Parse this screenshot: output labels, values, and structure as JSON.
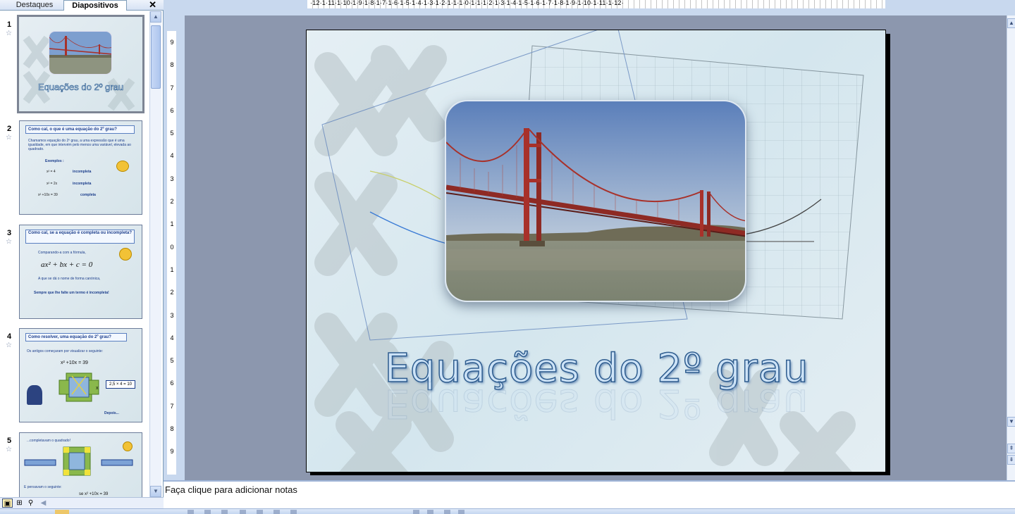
{
  "panel": {
    "tabs": [
      "Destaques",
      "Diapositivos"
    ],
    "active_tab": "Diapositivos",
    "close_glyph": "✕"
  },
  "thumbnails": [
    {
      "number": "1",
      "title": "Equações do 2º grau",
      "selected": true
    },
    {
      "number": "2",
      "heading": "Como cal, o que é uma equação do 2º grau?",
      "body": "Chamamos equação do 2º grau, a uma expressão que é uma igualdade, em que intervém pelo menos uma variável, elevada ao quadrado.",
      "examples_label": "Exemplos :",
      "examples": [
        {
          "expr": "x² = 4",
          "result": "incompleta"
        },
        {
          "expr": "x² = 2x",
          "result": "incompleta"
        },
        {
          "expr": "x² +10x = 39",
          "result": "completa"
        }
      ]
    },
    {
      "number": "3",
      "heading": "Como cal, se a equação é completa ou incompleta?",
      "line1": "Comparando-a com a fórmula,",
      "formula": "ax² + bx + c = 0",
      "line2": "A que se dá o nome de forma canónica,",
      "line3": "Sempre que lhe falte um termo é incompleta!"
    },
    {
      "number": "4",
      "heading": "Como resolver, uma equação do 2º grau?",
      "line1": "Os antigos começaram por visualizar o seguinte:",
      "eq": "x² +10x = 39",
      "box": "2,5 × 4 = 10",
      "var": "x",
      "next": "Depois..."
    },
    {
      "number": "5",
      "line1": "...completavam o quadrado!",
      "line2": "E pensavam o seguinte:",
      "eq": "se x² +10x = 39"
    }
  ],
  "rulers": {
    "top": "·12·1·11·1·10·1·9·1·8·1·7·1·6·1·5·1·4·1·3·1·2·1·1·1·0·1·1·1·2·1·3·1·4·1·5·1·6·1·7·1·8·1·9·1·10·1·11·1·12·",
    "left": [
      "9",
      "8",
      "7",
      "6",
      "5",
      "4",
      "3",
      "2",
      "1",
      "0",
      "1",
      "2",
      "3",
      "4",
      "5",
      "6",
      "7",
      "8",
      "9"
    ]
  },
  "slide": {
    "title": "Equações do 2º grau",
    "photo_subject": "bridge"
  },
  "notes": {
    "placeholder": "Faça clique para adicionar notas"
  },
  "view_buttons": [
    "normal-view",
    "slide-sorter-view",
    "slide-show-view"
  ],
  "colors": {
    "accent": "#2f5d8f",
    "stage": "#8c97ae",
    "bridge": "#a8312a"
  }
}
